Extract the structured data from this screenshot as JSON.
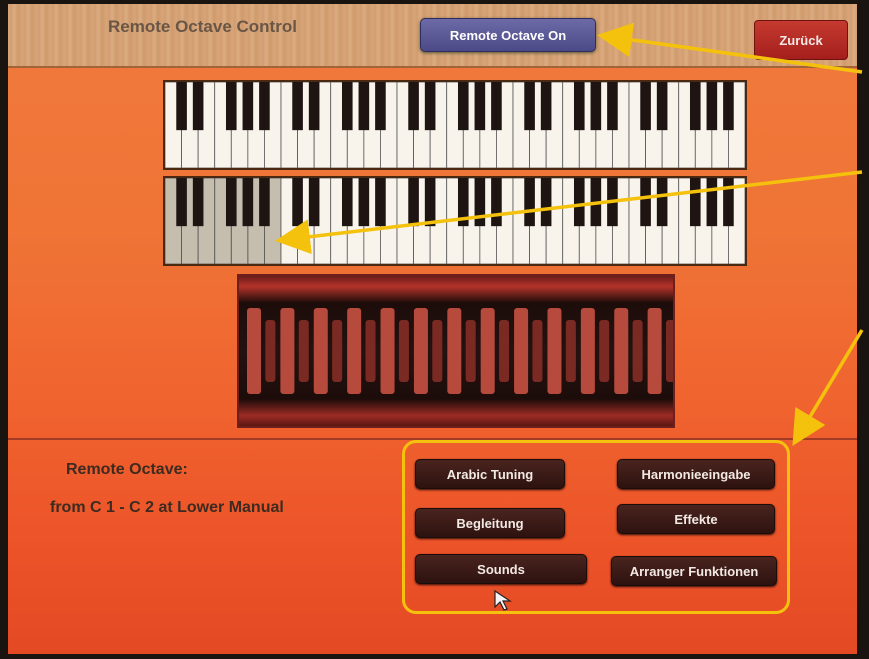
{
  "header": {
    "title": "Remote Octave Control",
    "remote_octave_button": "Remote Octave On",
    "back_button": "Zurück"
  },
  "info": {
    "label": "Remote Octave:",
    "range": "from C 1 - C 2 at Lower Manual"
  },
  "function_buttons": [
    {
      "label": "Arabic Tuning"
    },
    {
      "label": "Harmonieeingabe"
    },
    {
      "label": "Begleitung"
    },
    {
      "label": "Effekte"
    },
    {
      "label": "Sounds"
    },
    {
      "label": "Arranger Funktionen"
    }
  ],
  "colors": {
    "annotation_arrow": "#f4c10c",
    "remote_button": "#5a5797",
    "back_button": "#b52a25"
  },
  "manuals": {
    "upper": {
      "name": "upper-manual"
    },
    "lower": {
      "name": "lower-manual",
      "remote_octave_active": "C 1 - C 2"
    }
  }
}
